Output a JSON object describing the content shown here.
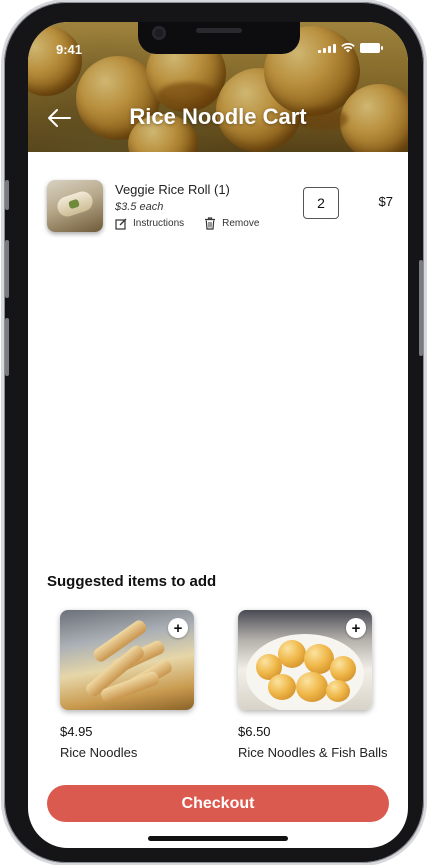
{
  "status_bar": {
    "time": "9:41"
  },
  "header": {
    "title": "Rice Noodle Cart"
  },
  "cart": {
    "items": [
      {
        "name": "Veggie Rice Roll (1)",
        "unit_price": "$3.5 each",
        "instructions_label": "Instructions",
        "remove_label": "Remove",
        "quantity": "2",
        "total": "$7"
      }
    ]
  },
  "suggestions": {
    "heading": "Suggested items to add",
    "items": [
      {
        "price": "$4.95",
        "name": "Rice Noodles",
        "add_symbol": "+"
      },
      {
        "price": "$6.50",
        "name": "Rice Noodles & Fish Balls",
        "add_symbol": "+"
      }
    ]
  },
  "checkout": {
    "label": "Checkout"
  },
  "colors": {
    "accent": "#db5a4f"
  }
}
